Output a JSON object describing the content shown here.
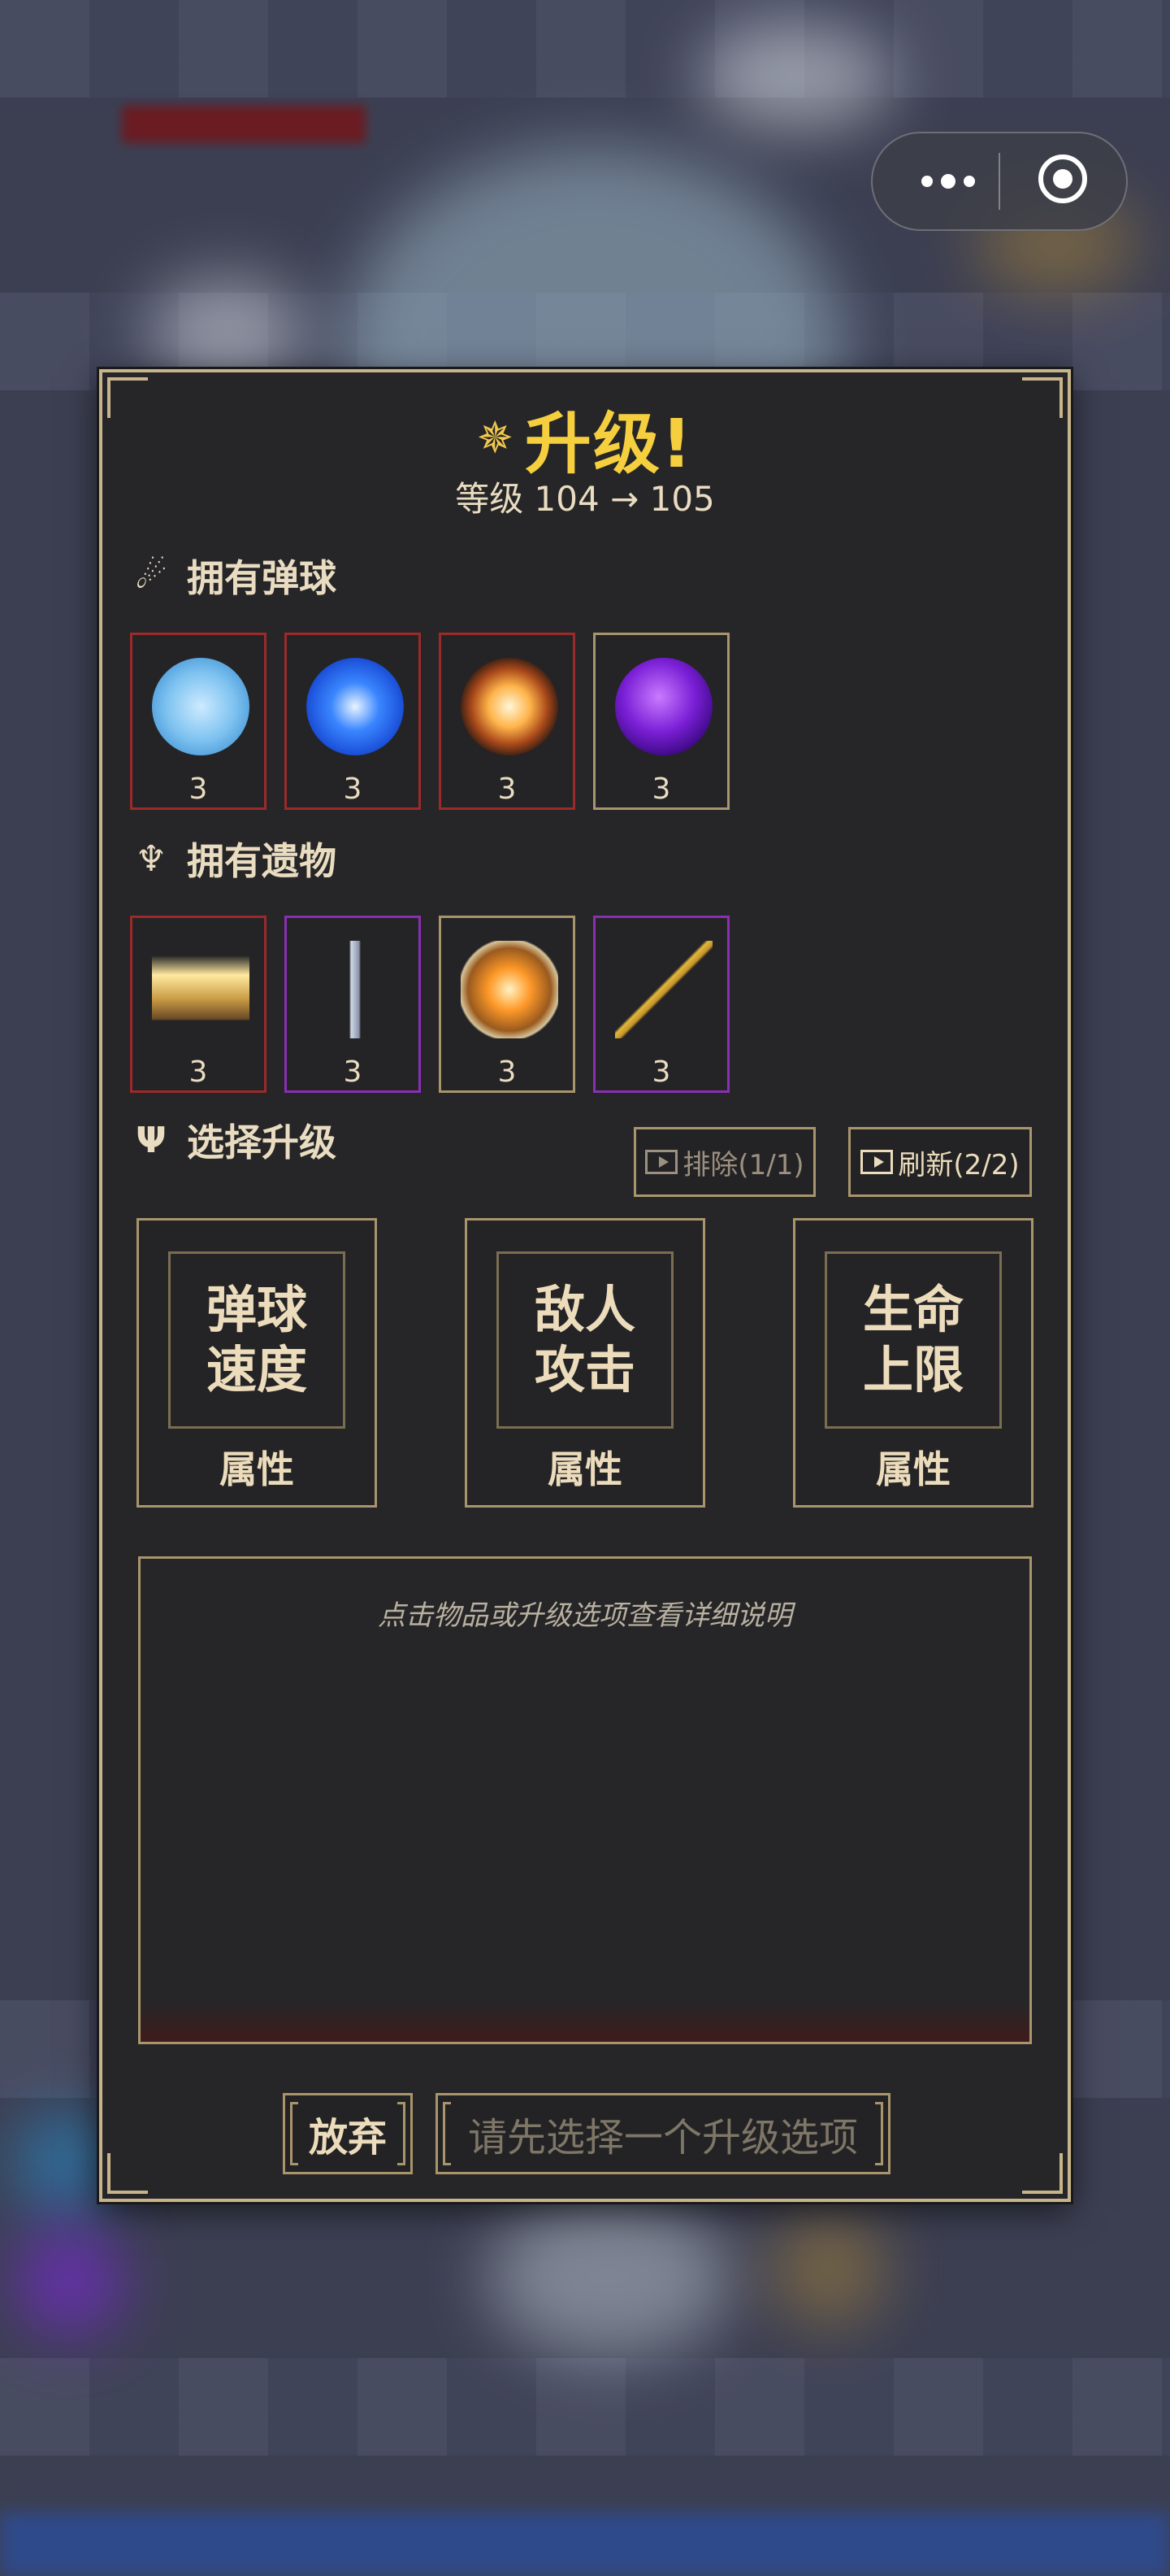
{
  "dialog": {
    "title": "升级!",
    "subtitle": "等级 104 → 105",
    "title_color": "#f6cf3f",
    "frame_color": "#c8b48a"
  },
  "owned_balls": {
    "heading": "拥有弹球",
    "icon": "comet-icon",
    "items": [
      {
        "name": "ice-orb",
        "count": "3",
        "rarity_color": "#9c2a2a"
      },
      {
        "name": "lightning-orb",
        "count": "3",
        "rarity_color": "#9c2a2a"
      },
      {
        "name": "fire-orb",
        "count": "3",
        "rarity_color": "#9c2a2a"
      },
      {
        "name": "void-orb",
        "count": "3",
        "rarity_color": "#a8956b"
      }
    ]
  },
  "owned_relics": {
    "heading": "拥有遗物",
    "icon": "chalice-icon",
    "items": [
      {
        "name": "spell-book",
        "count": "3",
        "rarity_color": "#9c2a2a"
      },
      {
        "name": "sword",
        "count": "3",
        "rarity_color": "#8a2fb2"
      },
      {
        "name": "amulet",
        "count": "3",
        "rarity_color": "#a8956b"
      },
      {
        "name": "golden-arrow",
        "count": "3",
        "rarity_color": "#8a2fb2"
      }
    ]
  },
  "choose_upgrade": {
    "heading": "选择升级",
    "icon": "trident-icon",
    "exclude_label": "排除(1/1)",
    "refresh_label": "刷新(2/2)",
    "options": [
      {
        "line1": "弹球",
        "line2": "速度",
        "type": "属性"
      },
      {
        "line1": "敌人",
        "line2": "攻击",
        "type": "属性"
      },
      {
        "line1": "生命",
        "line2": "上限",
        "type": "属性"
      }
    ]
  },
  "description": {
    "hint": "点击物品或升级选项查看详细说明"
  },
  "actions": {
    "give_up": "放弃",
    "confirm_placeholder": "请先选择一个升级选项"
  }
}
